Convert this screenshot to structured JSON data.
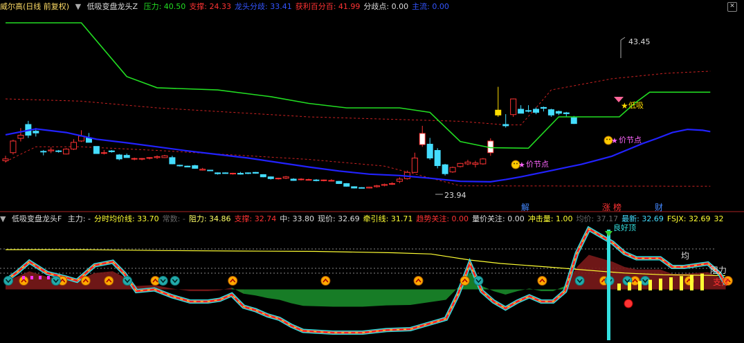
{
  "main_header": {
    "stock": "威尔高(日线 前复权)",
    "indicator": "低吸变盘龙头Z",
    "items": [
      {
        "label": "压力: ",
        "value": "40.50",
        "color": "#22dd22"
      },
      {
        "label": "支撑: ",
        "value": "24.33",
        "color": "#ff3333"
      },
      {
        "label": "龙头分歧: ",
        "value": "33.41",
        "color": "#3355ff"
      },
      {
        "label": "获利百分百: ",
        "value": "41.99",
        "color": "#ff3333"
      },
      {
        "label": "分歧点: ",
        "value": "0.00",
        "color": "#dddddd"
      },
      {
        "label": "主流: ",
        "value": "0.00",
        "color": "#3355ff"
      }
    ]
  },
  "sub_header": {
    "indicator": "低吸变盘龙头F",
    "items": [
      {
        "label": "主力: ",
        "value": "-",
        "color": "#dddddd"
      },
      {
        "label": "分时均价线: ",
        "value": "33.70",
        "color": "#ffff33"
      },
      {
        "label": "常数: ",
        "value": "-",
        "color": "#666666"
      },
      {
        "label": "阻力: ",
        "value": "34.86",
        "color": "#ffff66"
      },
      {
        "label": "支撑: ",
        "value": "32.74",
        "color": "#ff3333"
      },
      {
        "label": "中: ",
        "value": "33.80",
        "color": "#dddddd"
      },
      {
        "label": "现价: ",
        "value": "32.69",
        "color": "#dddddd"
      },
      {
        "label": "牵引线: ",
        "value": "31.71",
        "color": "#ffff33"
      },
      {
        "label": "趋势关注: ",
        "value": "0.00",
        "color": "#ff3333"
      },
      {
        "label": "量价关注: ",
        "value": "0.00",
        "color": "#dddddd"
      },
      {
        "label": "冲击量: ",
        "value": "1.00",
        "color": "#ffff33"
      },
      {
        "label": "均价: ",
        "value": "37.17",
        "color": "#666666"
      },
      {
        "label": "最新: ",
        "value": "32.69",
        "color": "#44ddff"
      },
      {
        "label": "FSJX: ",
        "value": "32.69",
        "color": "#ffff33"
      },
      {
        "label": "",
        "value": "32",
        "color": "#ffff33"
      }
    ]
  },
  "chart_data": [
    {
      "type": "candlestick",
      "title": "低吸变盘龙头Z",
      "candles": [
        [
          21.2,
          22.3,
          20.8,
          21.6
        ],
        [
          23.0,
          25.9,
          22.6,
          25.6
        ],
        [
          26.2,
          28.5,
          25.5,
          26.9
        ],
        [
          29.3,
          30.1,
          26.3,
          26.9
        ],
        [
          27.8,
          28.5,
          26.6,
          27.4
        ],
        [
          23.3,
          23.6,
          22.4,
          23.2
        ],
        [
          23.4,
          24.2,
          22.9,
          23.6
        ],
        [
          23.4,
          23.6,
          23.0,
          23.3
        ],
        [
          22.7,
          24.0,
          22.6,
          23.8
        ],
        [
          23.8,
          26.0,
          23.6,
          25.3
        ],
        [
          25.6,
          28.0,
          25.4,
          26.7
        ],
        [
          26.3,
          27.4,
          25.8,
          25.3
        ],
        [
          24.4,
          24.4,
          22.8,
          22.8
        ],
        [
          22.9,
          23.6,
          22.6,
          23.0
        ],
        [
          23.4,
          23.6,
          23.0,
          23.2
        ],
        [
          22.5,
          22.7,
          21.3,
          21.6
        ],
        [
          22.4,
          22.8,
          22.0,
          21.9
        ],
        [
          21.6,
          21.9,
          21.3,
          21.7
        ],
        [
          21.6,
          21.8,
          21.3,
          21.7
        ],
        [
          21.8,
          22.0,
          21.5,
          21.9
        ],
        [
          21.9,
          22.4,
          21.6,
          22.1
        ],
        [
          21.9,
          22.5,
          21.8,
          22.3
        ],
        [
          21.9,
          22.3,
          20.4,
          20.5
        ],
        [
          20.2,
          20.3,
          19.9,
          20.1
        ],
        [
          20.0,
          20.1,
          19.8,
          19.8
        ],
        [
          20.1,
          20.3,
          19.4,
          19.5
        ],
        [
          19.1,
          19.6,
          19.0,
          19.3
        ],
        [
          19.1,
          19.1,
          18.9,
          19.0
        ],
        [
          18.5,
          18.6,
          18.1,
          18.3
        ],
        [
          18.5,
          18.6,
          18.3,
          18.4
        ],
        [
          18.3,
          18.5,
          18.1,
          18.4
        ],
        [
          18.4,
          18.7,
          18.1,
          18.2
        ],
        [
          18.5,
          18.6,
          18.2,
          18.4
        ],
        [
          18.6,
          18.7,
          18.3,
          18.4
        ],
        [
          18.1,
          18.2,
          17.5,
          17.6
        ],
        [
          17.6,
          17.7,
          17.0,
          17.2
        ],
        [
          17.2,
          17.4,
          17.0,
          17.3
        ],
        [
          17.3,
          17.8,
          17.1,
          17.6
        ],
        [
          17.1,
          17.3,
          16.7,
          16.8
        ],
        [
          17.0,
          17.3,
          16.8,
          17.1
        ],
        [
          17.0,
          17.2,
          16.8,
          17.0
        ],
        [
          16.9,
          17.1,
          16.6,
          16.8
        ],
        [
          16.8,
          17.0,
          16.6,
          16.9
        ],
        [
          16.8,
          17.1,
          16.6,
          16.8
        ],
        [
          16.6,
          16.7,
          16.0,
          16.1
        ],
        [
          16.1,
          16.2,
          15.4,
          15.5
        ],
        [
          15.4,
          15.5,
          15.0,
          15.1
        ],
        [
          15.2,
          15.3,
          15.0,
          15.1
        ],
        [
          15.1,
          15.4,
          15.0,
          15.3
        ],
        [
          15.4,
          15.8,
          15.2,
          15.6
        ],
        [
          15.7,
          16.1,
          15.5,
          15.9
        ],
        [
          16.0,
          16.4,
          15.8,
          16.1
        ],
        [
          16.6,
          17.5,
          16.2,
          17.1
        ],
        [
          17.2,
          19.0,
          17.0,
          18.6
        ],
        [
          18.6,
          23.0,
          18.5,
          21.8
        ],
        [
          24.8,
          29.0,
          24.3,
          27.3
        ],
        [
          24.9,
          26.3,
          21.4,
          21.8
        ],
        [
          23.5,
          24.0,
          19.5,
          20.1
        ],
        [
          20.3,
          20.5,
          17.9,
          18.3
        ],
        [
          18.7,
          19.9,
          18.5,
          19.7
        ],
        [
          19.9,
          20.7,
          19.7,
          20.6
        ],
        [
          20.5,
          21.4,
          20.2,
          20.9
        ],
        [
          20.4,
          21.2,
          19.7,
          20.7
        ],
        [
          20.5,
          21.8,
          20.3,
          21.6
        ],
        [
          23.0,
          26.2,
          22.3,
          25.6
        ],
        [
          31.4,
          37.7,
          31.0,
          32.5
        ],
        [
          29.3,
          31.6,
          28.6,
          29.0
        ],
        [
          31.5,
          35.1,
          31.0,
          35.0
        ],
        [
          32.7,
          33.6,
          31.9,
          31.8
        ],
        [
          32.4,
          33.6,
          32.0,
          32.3
        ],
        [
          32.7,
          33.1,
          31.6,
          32.0
        ],
        [
          33.1,
          33.3,
          32.2,
          32.9
        ],
        [
          32.6,
          32.8,
          31.0,
          31.4
        ],
        [
          32.2,
          32.4,
          31.4,
          31.8
        ],
        [
          31.9,
          32.1,
          31.0,
          31.7
        ],
        [
          30.8,
          31.2,
          29.4,
          29.5
        ]
      ],
      "pressure_line": [
        [
          0,
          52
        ],
        [
          10,
          52
        ],
        [
          16,
          40
        ],
        [
          20,
          37.5
        ],
        [
          28,
          37
        ],
        [
          35,
          35.5
        ],
        [
          40,
          34
        ],
        [
          45,
          33
        ],
        [
          52,
          33
        ],
        [
          56,
          32
        ],
        [
          60,
          25.5
        ],
        [
          64,
          24.1
        ],
        [
          69,
          24
        ],
        [
          73,
          31
        ],
        [
          81,
          31
        ],
        [
          83,
          34
        ],
        [
          85,
          36.5
        ],
        [
          93,
          36.5
        ]
      ],
      "support_line_dashed": [
        [
          0,
          35
        ],
        [
          10,
          34.5
        ],
        [
          20,
          33
        ],
        [
          30,
          32
        ],
        [
          40,
          31
        ],
        [
          50,
          30.5
        ],
        [
          60,
          30
        ],
        [
          66,
          29.2
        ],
        [
          68,
          29.2
        ],
        [
          70,
          33
        ],
        [
          72,
          37
        ],
        [
          80,
          39.5
        ],
        [
          87,
          40.7
        ],
        [
          93,
          41.2
        ]
      ],
      "lower_dashed": [
        [
          0,
          21
        ],
        [
          4,
          24.3
        ],
        [
          10,
          24.3
        ],
        [
          20,
          23.5
        ],
        [
          30,
          22.5
        ],
        [
          40,
          21.5
        ],
        [
          50,
          20
        ],
        [
          60,
          15.6
        ],
        [
          93,
          15.5
        ]
      ],
      "blue_avg": [
        [
          0,
          27
        ],
        [
          4,
          28.3
        ],
        [
          8,
          27.5
        ],
        [
          12,
          26
        ],
        [
          16,
          25.2
        ],
        [
          20,
          24.3
        ],
        [
          24,
          23.4
        ],
        [
          28,
          22.6
        ],
        [
          32,
          21.8
        ],
        [
          36,
          20.8
        ],
        [
          40,
          19.8
        ],
        [
          44,
          18.9
        ],
        [
          48,
          18.2
        ],
        [
          52,
          17.9
        ],
        [
          56,
          17.3
        ],
        [
          60,
          16.6
        ],
        [
          64,
          16.5
        ],
        [
          66,
          17.0
        ],
        [
          68,
          17.6
        ],
        [
          70,
          18.3
        ],
        [
          72,
          19.0
        ],
        [
          74,
          19.7
        ],
        [
          76,
          20.4
        ],
        [
          78,
          21.3
        ],
        [
          80,
          22.2
        ],
        [
          82,
          23.6
        ],
        [
          84,
          25.0
        ],
        [
          86,
          26.2
        ],
        [
          88,
          27.5
        ],
        [
          90,
          28.2
        ],
        [
          92,
          28.0
        ],
        [
          93,
          27.7
        ]
      ],
      "ylim": [
        12.0,
        54.0
      ],
      "high_label": "43.45",
      "low_label": "23.94",
      "annotations": [
        "价节点",
        "价节点",
        "价节点",
        "低吸"
      ],
      "event_labels": [
        "解",
        "涨",
        "榜",
        "财"
      ]
    },
    {
      "type": "line",
      "title": "低吸变盘龙头F",
      "x_count": 94,
      "ylim": [
        -12,
        52
      ],
      "yellow_avg": [
        [
          0,
          38
        ],
        [
          10,
          38
        ],
        [
          20,
          37.5
        ],
        [
          30,
          37.2
        ],
        [
          40,
          37
        ],
        [
          50,
          36.2
        ],
        [
          55,
          35.5
        ],
        [
          60,
          32
        ],
        [
          64,
          30
        ],
        [
          70,
          28
        ],
        [
          77,
          25.5
        ],
        [
          80,
          24.5
        ],
        [
          85,
          23.5
        ],
        [
          93,
          23
        ]
      ],
      "main_flow": [
        [
          0,
          20
        ],
        [
          2,
          25
        ],
        [
          4,
          31
        ],
        [
          7,
          24.5
        ],
        [
          10,
          22
        ],
        [
          12,
          20
        ],
        [
          15,
          29
        ],
        [
          18,
          31
        ],
        [
          20,
          24
        ],
        [
          22,
          14
        ],
        [
          25,
          15
        ],
        [
          28,
          11
        ],
        [
          31,
          8
        ],
        [
          34,
          8
        ],
        [
          36,
          9
        ],
        [
          38,
          12
        ],
        [
          40,
          5
        ],
        [
          42,
          3
        ],
        [
          44,
          0
        ],
        [
          46,
          -2
        ],
        [
          48,
          -6
        ],
        [
          50,
          -9
        ],
        [
          55,
          -10
        ],
        [
          60,
          -10
        ],
        [
          64,
          -8.5
        ],
        [
          68,
          -8
        ],
        [
          70,
          -6
        ],
        [
          72,
          -4
        ],
        [
          74,
          -2
        ],
        [
          76,
          12
        ],
        [
          78,
          30
        ],
        [
          80,
          14
        ],
        [
          82,
          8
        ],
        [
          84,
          4
        ],
        [
          86,
          8
        ],
        [
          88,
          11
        ],
        [
          90,
          8
        ],
        [
          92,
          8
        ],
        [
          94,
          14
        ],
        [
          96,
          36
        ],
        [
          98,
          50
        ],
        [
          100,
          46
        ],
        [
          102,
          42
        ],
        [
          104,
          36
        ],
        [
          106,
          33
        ],
        [
          108,
          33
        ],
        [
          110,
          33
        ],
        [
          112,
          28
        ],
        [
          114,
          28
        ],
        [
          116,
          29
        ],
        [
          118,
          30
        ],
        [
          120,
          24
        ],
        [
          121,
          18
        ]
      ],
      "resistance_label": "阻力",
      "support_label": "支撑",
      "avg_label": "均",
      "top_label": "良好顶",
      "arrow_markers": [
        2,
        7,
        10,
        13,
        19,
        29,
        41,
        53,
        59,
        69,
        77,
        81,
        88,
        93
      ],
      "teal_markers": [
        0,
        8,
        20,
        26,
        28,
        79,
        96,
        101,
        104,
        107
      ]
    }
  ]
}
